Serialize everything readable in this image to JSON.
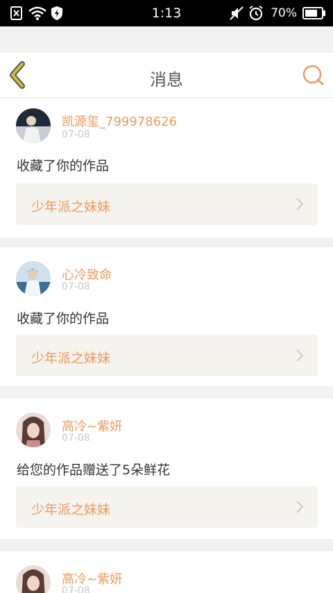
{
  "status_bar": {
    "time": "1:13",
    "battery": "70%"
  },
  "header": {
    "title": "消息"
  },
  "colors": {
    "accent": "#ef9a5d",
    "back_icon": "#c9c237",
    "work_bg": "#f4f3ee"
  },
  "messages": [
    {
      "username": "凯源玺_799978626",
      "date": "07-08",
      "text": "收藏了你的作品",
      "work_title": "少年派之妹妹"
    },
    {
      "username": "心冷致命",
      "date": "07-08",
      "text": "收藏了你的作品",
      "work_title": "少年派之妹妹"
    },
    {
      "username": "高冷~紫妍",
      "date": "07-08",
      "text": "给您的作品赠送了5朵鲜花",
      "work_title": "少年派之妹妹"
    },
    {
      "username": "高冷~紫妍",
      "date": "07-08",
      "text": "",
      "work_title": ""
    }
  ]
}
